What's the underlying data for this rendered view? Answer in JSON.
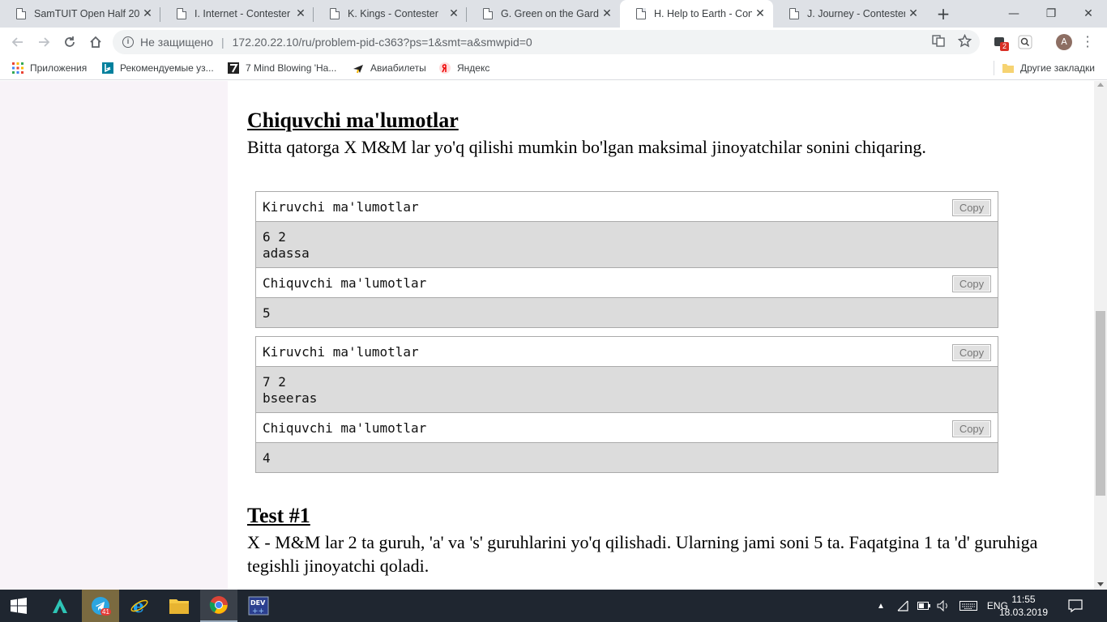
{
  "browser": {
    "tabs": [
      {
        "title": "SamTUIT Open Half 20",
        "active": false
      },
      {
        "title": "I. Internet - Contester",
        "active": false
      },
      {
        "title": "K. Kings - Contester",
        "active": false
      },
      {
        "title": "G. Green on the Garden",
        "active": false
      },
      {
        "title": "H. Help to Earth - Conte",
        "active": true
      },
      {
        "title": "J. Journey - Contester",
        "active": false
      }
    ],
    "close_glyph": "✕",
    "new_tab_glyph": "+",
    "window_controls": {
      "minimize": "—",
      "restore": "❐",
      "close": "✕"
    },
    "security_label": "Не защищено",
    "url": "172.20.22.10/ru/problem-pid-c363?ps=1&smt=a&smwpid=0",
    "extension_badge": "2",
    "avatar_letter": "A"
  },
  "bookmarks": {
    "apps": "Приложения",
    "items": [
      "Рекомендуемые уз...",
      "7 Mind Blowing 'Ha...",
      "Авиабилеты",
      "Яндекс"
    ],
    "other": "Другие закладки"
  },
  "problem": {
    "output_heading": "Chiquvchi ma'lumotlar",
    "output_text": "Bitta qatorga X M&M lar yo'q qilishi mumkin bo'lgan maksimal jinoyatchilar sonini chiqaring.",
    "samples": [
      {
        "input_label": "Kiruvchi ma'lumotlar",
        "input": "6 2\nadassa",
        "output_label": "Chiquvchi ma'lumotlar",
        "output": "5",
        "copy_label": "Copy"
      },
      {
        "input_label": "Kiruvchi ma'lumotlar",
        "input": "7 2\nbseeras",
        "output_label": "Chiquvchi ma'lumotlar",
        "output": "4",
        "copy_label": "Copy"
      }
    ],
    "test_heading": "Test #1",
    "test_text": "X - M&M lar 2 ta guruh, 'a' va 's' guruhlarini yo'q qilishadi. Ularning jami soni 5 ta. Faqatgina 1 ta 'd' guruhiga tegishli jinoyatchi qoladi."
  },
  "taskbar": {
    "telegram_badge": "41",
    "language": "ENG",
    "time": "11:55",
    "date": "18.03.2019"
  }
}
